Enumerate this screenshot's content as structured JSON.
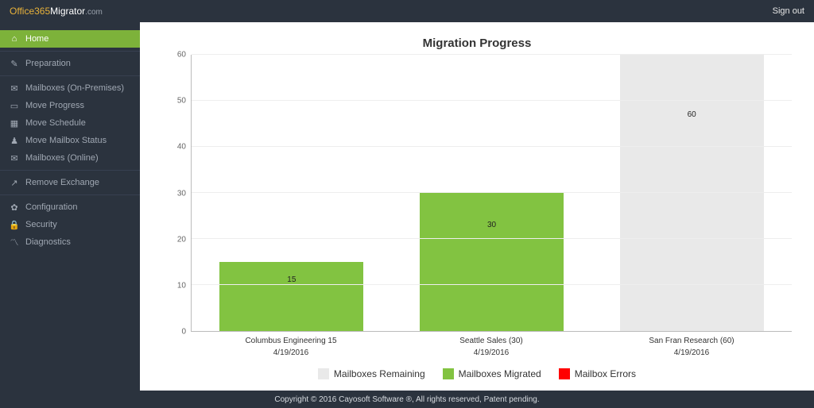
{
  "brand": {
    "part1": "Office365",
    "part2": "Migrator",
    "part3": ".com"
  },
  "topbar": {
    "signout": "Sign out"
  },
  "sidebar": {
    "groups": [
      {
        "items": [
          {
            "icon": "⌂",
            "label": "Home",
            "active": true
          }
        ]
      },
      {
        "items": [
          {
            "icon": "✎",
            "label": "Preparation"
          }
        ]
      },
      {
        "items": [
          {
            "icon": "✉",
            "label": "Mailboxes (On-Premises)"
          },
          {
            "icon": "▭",
            "label": "Move Progress"
          },
          {
            "icon": "▦",
            "label": "Move Schedule"
          },
          {
            "icon": "♟",
            "label": "Move Mailbox Status"
          },
          {
            "icon": "✉",
            "label": "Mailboxes (Online)"
          }
        ]
      },
      {
        "items": [
          {
            "icon": "↗",
            "label": "Remove Exchange"
          }
        ]
      },
      {
        "items": [
          {
            "icon": "✿",
            "label": "Configuration"
          },
          {
            "icon": "🔒",
            "label": "Security"
          },
          {
            "icon": "〽",
            "label": "Diagnostics"
          }
        ]
      }
    ]
  },
  "chart_data": {
    "type": "bar",
    "title": "Migration Progress",
    "ylim": [
      0,
      60
    ],
    "yticks": [
      0,
      10,
      20,
      30,
      40,
      50,
      60
    ],
    "categories": [
      "Columbus Engineering 15",
      "Seattle Sales (30)",
      "San Fran Research (60)"
    ],
    "dates": [
      "4/19/2016",
      "4/19/2016",
      "4/19/2016"
    ],
    "series": [
      {
        "name": "Mailboxes Remaining",
        "color": "gray",
        "values": [
          0,
          0,
          60
        ]
      },
      {
        "name": "Mailboxes Migrated",
        "color": "green",
        "values": [
          15,
          30,
          0
        ]
      },
      {
        "name": "Mailbox Errors",
        "color": "red",
        "values": [
          0,
          0,
          0
        ]
      }
    ],
    "display_value": [
      15,
      30,
      60
    ],
    "display_color": [
      "green",
      "green",
      "gray"
    ]
  },
  "footer": {
    "text": "Copyright © 2016 Cayosoft Software ®, All rights reserved, Patent pending."
  }
}
